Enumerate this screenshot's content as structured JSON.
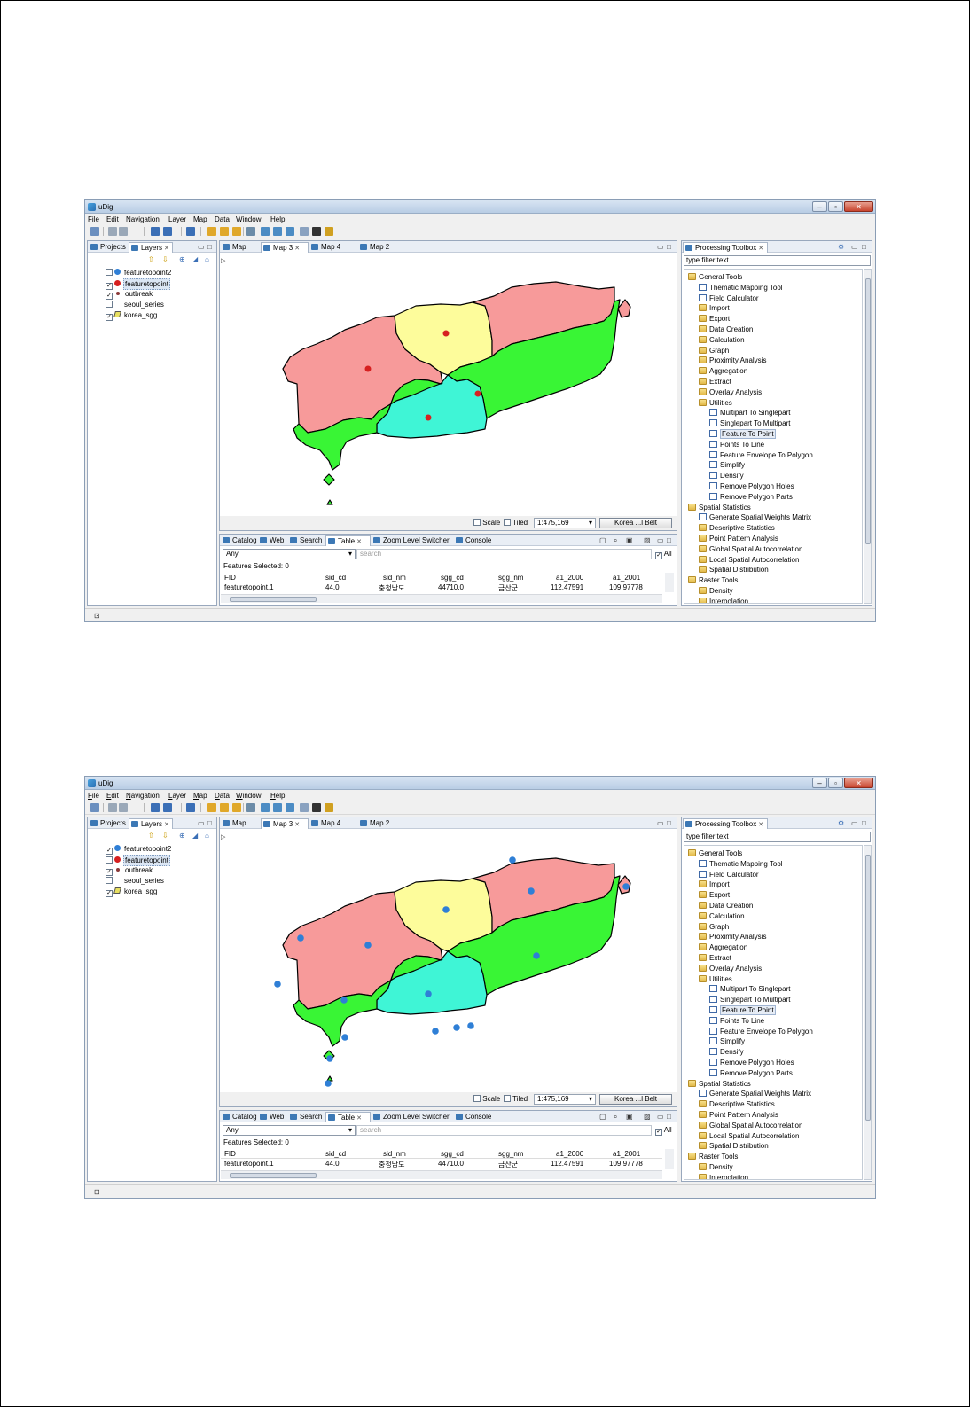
{
  "app": {
    "title": "uDig"
  },
  "menu": [
    "File",
    "Edit",
    "Navigation",
    "Layer",
    "Map",
    "Data",
    "Window",
    "Help"
  ],
  "left_tabs": [
    "Projects",
    "Layers"
  ],
  "map_tabs": [
    "Map",
    "Map 3",
    "Map 4",
    "Map 2"
  ],
  "bottom_tabs": [
    "Catalog",
    "Web",
    "Search",
    "Table",
    "Zoom Level Switcher",
    "Console"
  ],
  "proc_tab": "Processing Toolbox",
  "proc_filter_placeholder": "type filter text",
  "map_status": {
    "scale_label": "Scale",
    "tiled_label": "Tiled",
    "scale_value": "1:475,169",
    "crs": "Korea ...l Belt"
  },
  "table": {
    "filter": "Any",
    "search_placeholder": "search",
    "all_label": "All",
    "features_selected": "Features Selected: 0",
    "columns": [
      "FID",
      "sid_cd",
      "sid_nm",
      "sgg_cd",
      "sgg_nm",
      "a1_2000",
      "a1_2001"
    ],
    "row": [
      "featuretopoint.1",
      "44.0",
      "충청남도",
      "44710.0",
      "금산군",
      "112.47591",
      "109.97778"
    ]
  },
  "screenshots": [
    {
      "layers": [
        {
          "name": "featuretopoint2",
          "checked": false,
          "color": "#2f7fd6",
          "selected": false
        },
        {
          "name": "featuretopoint",
          "checked": true,
          "color": "#d62020",
          "selected": true
        },
        {
          "name": "outbreak",
          "checked": true,
          "color": "#8b3a3a",
          "selected": false
        },
        {
          "name": "seoul_series",
          "checked": false,
          "color": "",
          "selected": false
        },
        {
          "name": "korea_sgg",
          "checked": true,
          "color": "#e8e060",
          "selected": false
        }
      ],
      "point_color": "#d62020"
    },
    {
      "layers": [
        {
          "name": "featuretopoint2",
          "checked": true,
          "color": "#2f7fd6",
          "selected": false
        },
        {
          "name": "featuretopoint",
          "checked": false,
          "color": "#d62020",
          "selected": true
        },
        {
          "name": "outbreak",
          "checked": true,
          "color": "#8b3a3a",
          "selected": false
        },
        {
          "name": "seoul_series",
          "checked": false,
          "color": "",
          "selected": false
        },
        {
          "name": "korea_sgg",
          "checked": true,
          "color": "#e8e060",
          "selected": false
        }
      ],
      "point_color": "#2f7fd6"
    }
  ],
  "map_colors": {
    "pink": "#f79a9a",
    "yellow": "#fdfc9b",
    "green": "#39f535",
    "cyan": "#3ff5d6"
  },
  "toolbox": [
    {
      "label": "General Tools",
      "type": "folder",
      "depth": 1
    },
    {
      "label": "Thematic Mapping Tool",
      "type": "tool",
      "depth": 2
    },
    {
      "label": "Field Calculator",
      "type": "tool",
      "depth": 2
    },
    {
      "label": "Import",
      "type": "folder",
      "depth": 2
    },
    {
      "label": "Export",
      "type": "folder",
      "depth": 2
    },
    {
      "label": "Data Creation",
      "type": "folder",
      "depth": 2
    },
    {
      "label": "Calculation",
      "type": "folder",
      "depth": 2
    },
    {
      "label": "Graph",
      "type": "folder",
      "depth": 2
    },
    {
      "label": "Proximity Analysis",
      "type": "folder",
      "depth": 2
    },
    {
      "label": "Aggregation",
      "type": "folder",
      "depth": 2
    },
    {
      "label": "Extract",
      "type": "folder",
      "depth": 2
    },
    {
      "label": "Overlay Analysis",
      "type": "folder",
      "depth": 2
    },
    {
      "label": "Utilities",
      "type": "folder",
      "depth": 2
    },
    {
      "label": "Multipart To Singlepart",
      "type": "tool",
      "depth": 3
    },
    {
      "label": "Singlepart To Multipart",
      "type": "tool",
      "depth": 3
    },
    {
      "label": "Feature To Point",
      "type": "tool",
      "depth": 3,
      "selected": true
    },
    {
      "label": "Points To Line",
      "type": "tool",
      "depth": 3
    },
    {
      "label": "Feature Envelope To Polygon",
      "type": "tool",
      "depth": 3
    },
    {
      "label": "Simplify",
      "type": "tool",
      "depth": 3
    },
    {
      "label": "Densify",
      "type": "tool",
      "depth": 3
    },
    {
      "label": "Remove Polygon Holes",
      "type": "tool",
      "depth": 3
    },
    {
      "label": "Remove Polygon Parts",
      "type": "tool",
      "depth": 3
    },
    {
      "label": "Spatial Statistics",
      "type": "folder",
      "depth": 1
    },
    {
      "label": "Generate Spatial Weights Matrix",
      "type": "tool",
      "depth": 2
    },
    {
      "label": "Descriptive Statistics",
      "type": "folder",
      "depth": 2
    },
    {
      "label": "Point Pattern Analysis",
      "type": "folder",
      "depth": 2
    },
    {
      "label": "Global Spatial Autocorrelation",
      "type": "folder",
      "depth": 2
    },
    {
      "label": "Local Spatial Autocorrelation",
      "type": "folder",
      "depth": 2
    },
    {
      "label": "Spatial Distribution",
      "type": "folder",
      "depth": 2
    },
    {
      "label": "Raster Tools",
      "type": "folder",
      "depth": 1
    },
    {
      "label": "Density",
      "type": "folder",
      "depth": 2
    },
    {
      "label": "Interpolation",
      "type": "folder",
      "depth": 2
    }
  ]
}
